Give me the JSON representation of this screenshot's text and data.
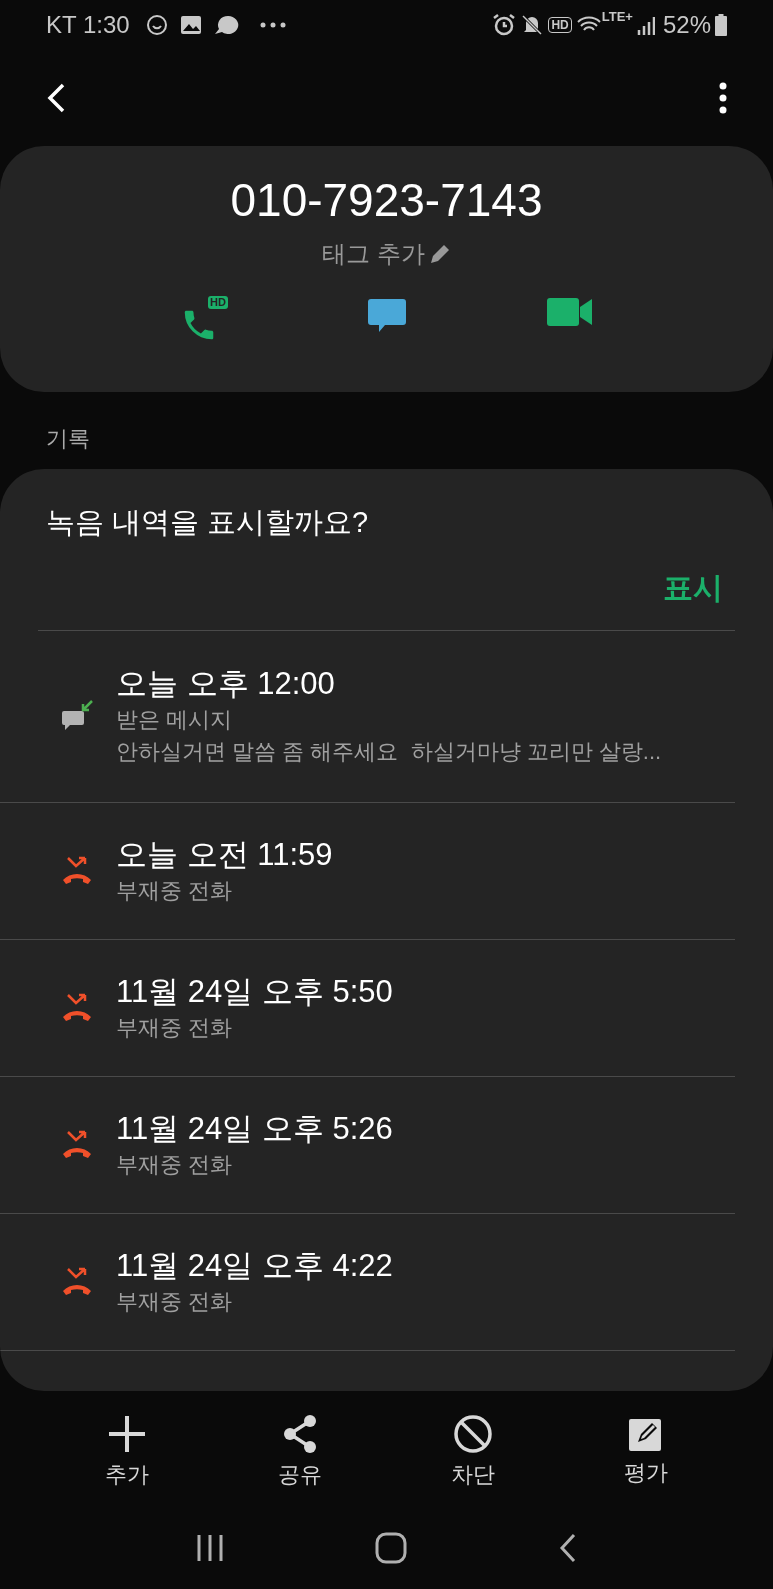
{
  "status_bar": {
    "carrier_time": "KT 1:30",
    "lte": "LTE+",
    "battery": "52%",
    "hd": "HD"
  },
  "contact": {
    "number": "010-7923-7143",
    "tag_button": "태그 추가",
    "call_badge": "HD"
  },
  "section_label": "기록",
  "recording_prompt": {
    "question": "녹음 내역을 표시할까요?",
    "action": "표시"
  },
  "history": [
    {
      "kind": "message",
      "time": "오늘 오후 12:00",
      "type": "받은 메시지",
      "preview": "안하실거면 말씀 좀 해주세요  하실거마냥 꼬리만 살랑..."
    },
    {
      "kind": "missed",
      "time": "오늘 오전 11:59",
      "type": "부재중 전화"
    },
    {
      "kind": "missed",
      "time": "11월 24일 오후 5:50",
      "type": "부재중 전화"
    },
    {
      "kind": "missed",
      "time": "11월 24일 오후 5:26",
      "type": "부재중 전화"
    },
    {
      "kind": "missed",
      "time": "11월 24일 오후 4:22",
      "type": "부재중 전화"
    }
  ],
  "actions": [
    {
      "kind": "add",
      "label": "추가"
    },
    {
      "kind": "share",
      "label": "공유"
    },
    {
      "kind": "block",
      "label": "차단"
    },
    {
      "kind": "rate",
      "label": "평가"
    }
  ]
}
